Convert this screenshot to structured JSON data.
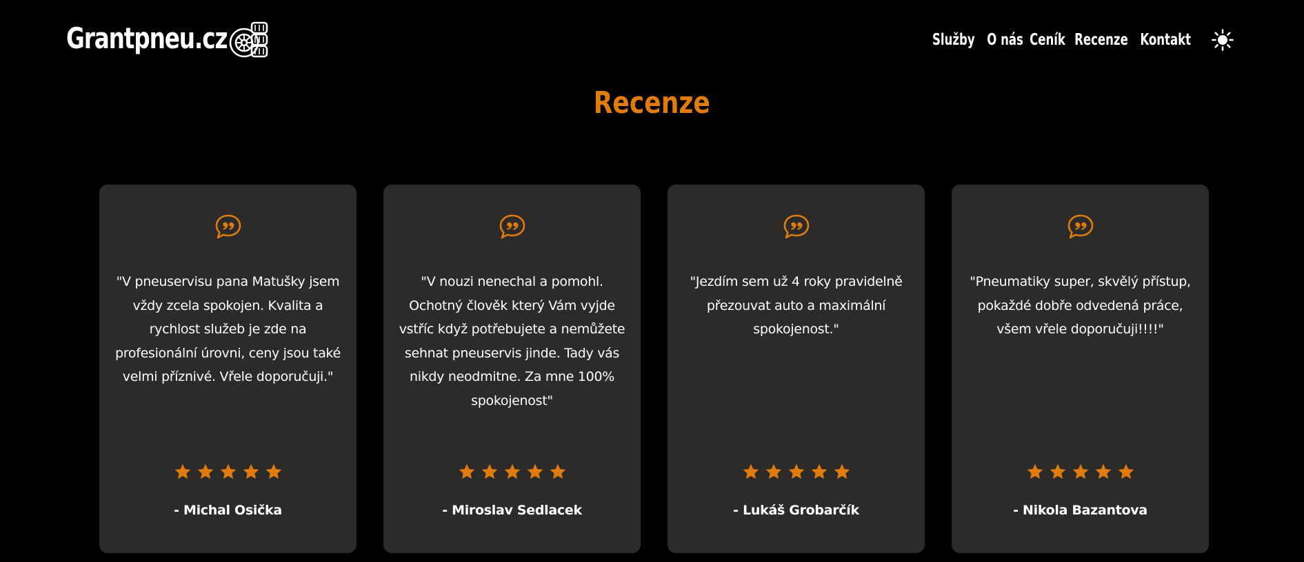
{
  "brand": {
    "name": "Grantpneu.cz",
    "logo_icon": "tire-stack-icon"
  },
  "nav": {
    "items": [
      {
        "label": "Služby"
      },
      {
        "label": "O nás"
      },
      {
        "label": "Ceník"
      },
      {
        "label": "Recenze"
      },
      {
        "label": "Kontakt"
      }
    ],
    "theme_toggle_icon": "sun-icon"
  },
  "section": {
    "title": "Recenze"
  },
  "colors": {
    "accent": "#e07b0e",
    "card_bg": "#2c2b2a",
    "page_bg": "#000000",
    "text": "#ffffff"
  },
  "reviews": [
    {
      "text": "\"V pneuservisu pana Matušky jsem vždy zcela spokojen. Kvalita a rychlost služeb je zde na profesionální úrovni, ceny jsou také velmi příznivé. Vřele doporučuji.\"",
      "rating": 5,
      "author": "- Michal Osička"
    },
    {
      "text": "\"V nouzi nenechal a pomohl. Ochotný člověk který Vám vyjde vstříc když potřebujete a nemůžete sehnat pneuservis jinde. Tady vás nikdy neodmitne. Za mne 100% spokojenost\"",
      "rating": 5,
      "author": "- Miroslav Sedlacek"
    },
    {
      "text": "\"Jezdím sem už 4 roky pravidelně přezouvat auto a maximální spokojenost.\"",
      "rating": 5,
      "author": "- Lukáš Grobarčík"
    },
    {
      "text": "\"Pneumatiky super, skvělý přístup, pokaždé dobře odvedená práce, všem vřele doporučuji!!!!\"",
      "rating": 5,
      "author": "- Nikola Bazantova"
    }
  ]
}
